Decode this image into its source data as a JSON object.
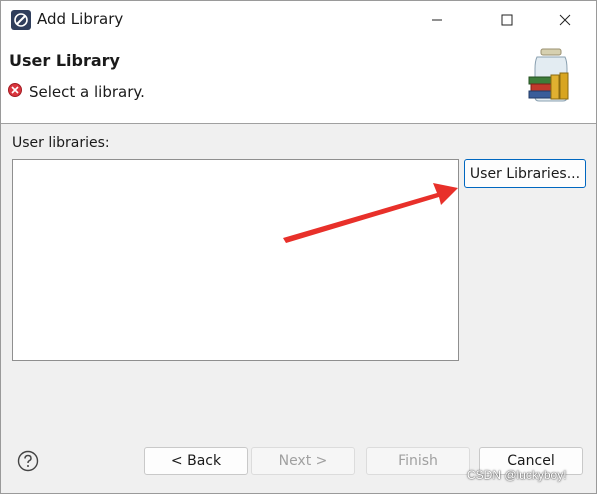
{
  "window": {
    "title": "Add Library",
    "icons": {
      "app": "eclipse-icon",
      "minimize": "minimize-icon",
      "maximize": "maximize-icon",
      "close": "close-icon"
    }
  },
  "banner": {
    "title": "User Library",
    "message": "Select a library.",
    "message_icon": "error-icon",
    "image": "library-jar-icon"
  },
  "body": {
    "list_label": "User libraries:",
    "items": [],
    "user_libraries_button": "User Libraries..."
  },
  "footer": {
    "help_icon": "help-icon",
    "back_button": "< Back",
    "next_button": "Next >",
    "finish_button": "Finish",
    "cancel_button": "Cancel"
  },
  "watermark": "CSDN @luckyboy!",
  "colors": {
    "accent": "#0067c0",
    "error": "#d9363e",
    "annotation_arrow": "#e8302a"
  }
}
